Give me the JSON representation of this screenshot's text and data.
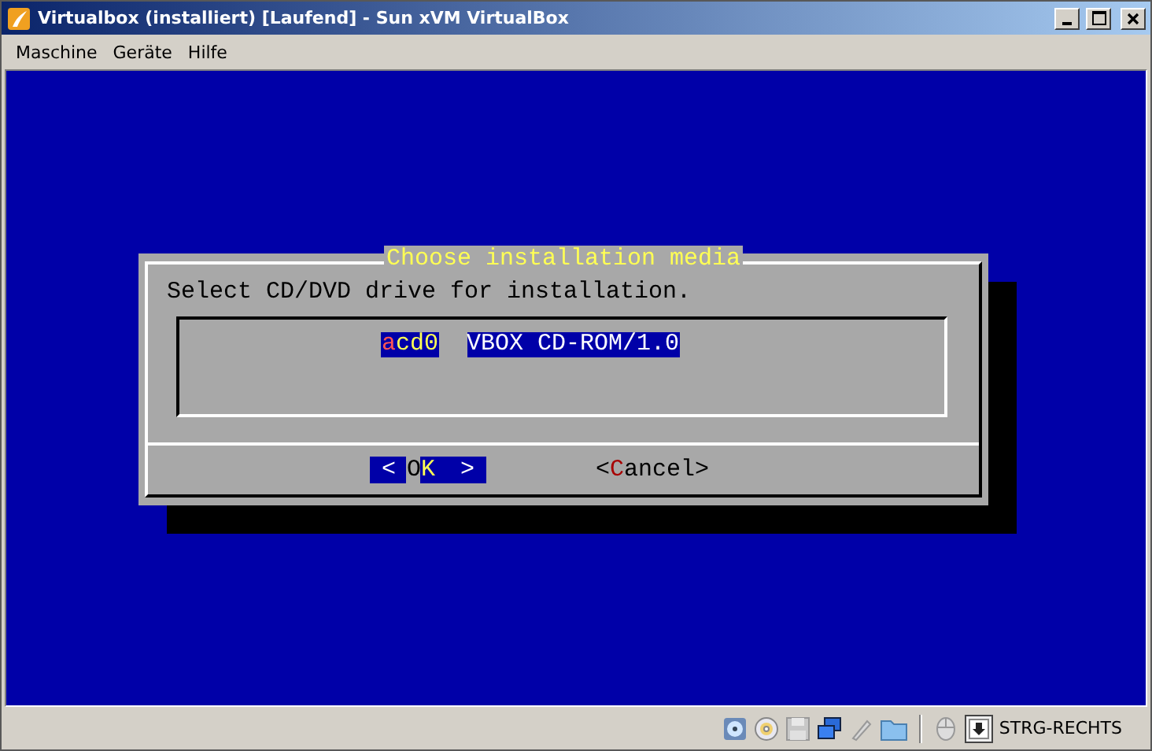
{
  "window": {
    "title": "Virtualbox (installiert) [Laufend] - Sun xVM VirtualBox"
  },
  "menu": [
    {
      "label": "Maschine"
    },
    {
      "label": "Geräte"
    },
    {
      "label": "Hilfe"
    }
  ],
  "dialog": {
    "title": "Choose installation media",
    "prompt": "Select CD/DVD drive for installation.",
    "items": [
      {
        "tag": "acd0",
        "description": "VBOX CD-ROM/1.0",
        "selected": true
      }
    ],
    "button_brackets": {
      "open": "<",
      "close": ">"
    },
    "buttons": [
      {
        "label": "OK",
        "selected": true
      },
      {
        "label": "Cancel",
        "selected": false
      }
    ]
  },
  "status_bar": {
    "host_key": "STRG-RECHTS"
  }
}
